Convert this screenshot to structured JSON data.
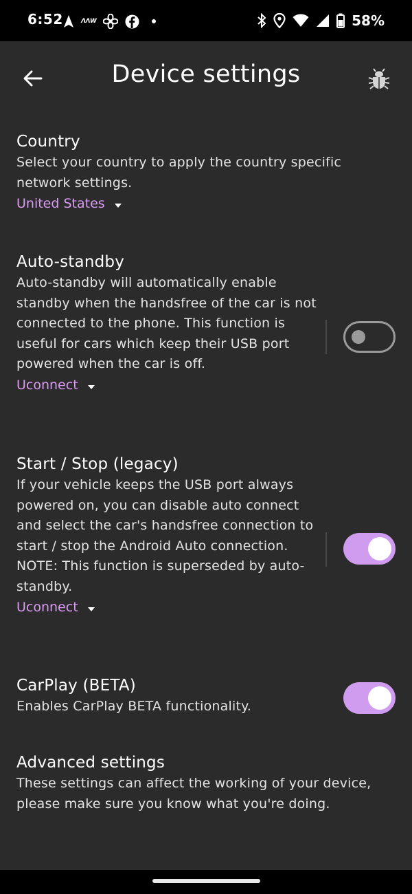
{
  "status_bar": {
    "time": "6:52",
    "mini_icon_text": "ΛΛW",
    "battery": "58%"
  },
  "app_bar": {
    "title": "Device settings",
    "back_icon": "arrow-left-icon",
    "bug_icon": "bug-icon"
  },
  "sections": {
    "country": {
      "title": "Country",
      "description": "Select your country to apply the country specific network settings.",
      "dropdown_value": "United States"
    },
    "auto_standby": {
      "title": "Auto-standby",
      "description": "Auto-standby will automatically enable standby when the handsfree of the car is not connected to the phone. This function is useful for cars which keep their USB port powered when the car is off.",
      "dropdown_value": "Uconnect",
      "enabled": false
    },
    "start_stop": {
      "title": "Start / Stop (legacy)",
      "description": "If your vehicle keeps the USB port always powered on, you can disable auto connect and select the car's handsfree connection to start / stop the Android Auto connection. NOTE: This function is superseded by auto-standby.",
      "dropdown_value": "Uconnect",
      "enabled": true
    },
    "carplay": {
      "title": "CarPlay (BETA)",
      "description": "Enables CarPlay BETA functionality.",
      "enabled": true
    },
    "advanced": {
      "title": "Advanced settings",
      "description": "These settings can affect the working of your device, please make sure you know what you're doing."
    }
  },
  "colors": {
    "background": "#2b2b2b",
    "accent": "#d99bf2",
    "switch_on": "#cf9cf0",
    "switch_off": "#9a9a9a"
  }
}
